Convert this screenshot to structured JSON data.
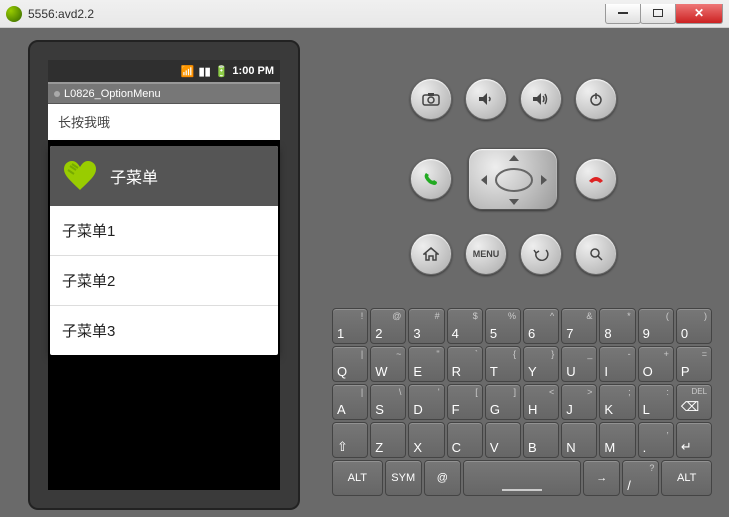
{
  "window": {
    "title": "5556:avd2.2"
  },
  "statusbar": {
    "time": "1:00 PM"
  },
  "app": {
    "title": "L0826_OptionMenu",
    "hint": "长按我哦"
  },
  "submenu": {
    "title": "子菜单",
    "items": [
      "子菜单1",
      "子菜单2",
      "子菜单3"
    ]
  },
  "controls": {
    "menu_label": "MENU"
  },
  "keyboard": {
    "row1": [
      {
        "main": "1",
        "sup": "!"
      },
      {
        "main": "2",
        "sup": "@"
      },
      {
        "main": "3",
        "sup": "#"
      },
      {
        "main": "4",
        "sup": "$"
      },
      {
        "main": "5",
        "sup": "%"
      },
      {
        "main": "6",
        "sup": "^"
      },
      {
        "main": "7",
        "sup": "&"
      },
      {
        "main": "8",
        "sup": "*"
      },
      {
        "main": "9",
        "sup": "("
      },
      {
        "main": "0",
        "sup": ")"
      }
    ],
    "row2": [
      {
        "main": "Q",
        "sup": "|"
      },
      {
        "main": "W",
        "sup": "~"
      },
      {
        "main": "E",
        "sup": "\""
      },
      {
        "main": "R",
        "sup": "`"
      },
      {
        "main": "T",
        "sup": "{"
      },
      {
        "main": "Y",
        "sup": "}"
      },
      {
        "main": "U",
        "sup": "_"
      },
      {
        "main": "I",
        "sup": "-"
      },
      {
        "main": "O",
        "sup": "+"
      },
      {
        "main": "P",
        "sup": "="
      }
    ],
    "row3": [
      {
        "main": "A",
        "sup": "|"
      },
      {
        "main": "S",
        "sup": "\\"
      },
      {
        "main": "D",
        "sup": "'"
      },
      {
        "main": "F",
        "sup": "["
      },
      {
        "main": "G",
        "sup": "]"
      },
      {
        "main": "H",
        "sup": "<"
      },
      {
        "main": "J",
        "sup": ">"
      },
      {
        "main": "K",
        "sup": ";"
      },
      {
        "main": "L",
        "sup": ":"
      },
      {
        "main": "",
        "sup": "DEL",
        "del": true
      }
    ],
    "row4": [
      {
        "main": "⇧",
        "sup": ""
      },
      {
        "main": "Z",
        "sup": ""
      },
      {
        "main": "X",
        "sup": ""
      },
      {
        "main": "C",
        "sup": ""
      },
      {
        "main": "V",
        "sup": ""
      },
      {
        "main": "B",
        "sup": ""
      },
      {
        "main": "N",
        "sup": ""
      },
      {
        "main": "M",
        "sup": ""
      },
      {
        "main": ".",
        "sup": ","
      },
      {
        "main": "↵",
        "sup": ""
      }
    ],
    "row5": {
      "alt_l": "ALT",
      "sym": "SYM",
      "at": "@",
      "space": "",
      "right": "→",
      "slash": "/",
      "q": "?",
      "alt_r": "ALT"
    }
  }
}
